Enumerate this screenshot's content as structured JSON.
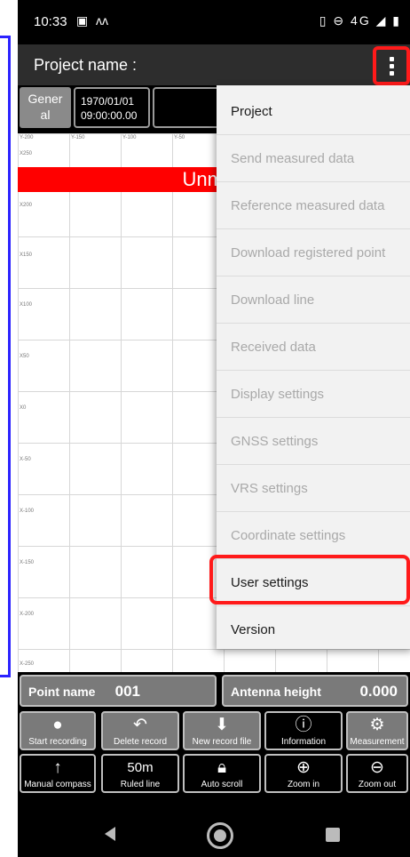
{
  "statusbar": {
    "time": "10:33",
    "network": "4G"
  },
  "appbar": {
    "title": "Project name :"
  },
  "infobar": {
    "general_label": "Gener\nal",
    "date": "1970/01/01",
    "time": "09:00:00.00"
  },
  "plot": {
    "banner": "Unmea",
    "x_ticks": [
      "Y-200",
      "Y-150",
      "Y-100",
      "Y-50"
    ],
    "y_ticks": [
      "X250",
      "X200",
      "X150",
      "X100",
      "X50",
      "X0",
      "X-50",
      "X-100",
      "X-150",
      "X-200",
      "X-250"
    ]
  },
  "fields": {
    "point_name_label": "Point name",
    "point_name_value": "001",
    "antenna_label": "Antenna height",
    "antenna_value": "0.000"
  },
  "toolbar": {
    "start_recording": "Start recording",
    "delete_record": "Delete record",
    "new_record_file": "New record file",
    "information": "Information",
    "measurement": "Measurement",
    "manual_compass": "Manual compass",
    "ruled_line_value": "50m",
    "ruled_line": "Ruled line",
    "auto_scroll": "Auto scroll",
    "zoom_in": "Zoom in",
    "zoom_out": "Zoom out"
  },
  "menu": {
    "items": [
      {
        "label": "Project",
        "enabled": true
      },
      {
        "label": "Send measured data",
        "enabled": false
      },
      {
        "label": "Reference measured data",
        "enabled": false
      },
      {
        "label": "Download registered point",
        "enabled": false
      },
      {
        "label": "Download line",
        "enabled": false
      },
      {
        "label": "Received data",
        "enabled": false
      },
      {
        "label": "Display settings",
        "enabled": false
      },
      {
        "label": "GNSS settings",
        "enabled": false
      },
      {
        "label": "VRS settings",
        "enabled": false
      },
      {
        "label": "Coordinate settings",
        "enabled": false
      },
      {
        "label": "User settings",
        "enabled": true
      },
      {
        "label": "Version",
        "enabled": true
      }
    ]
  },
  "colors": {
    "highlight": "#ff1a1a",
    "annotation_blue": "#2b22ff",
    "banner": "#ff0000"
  }
}
